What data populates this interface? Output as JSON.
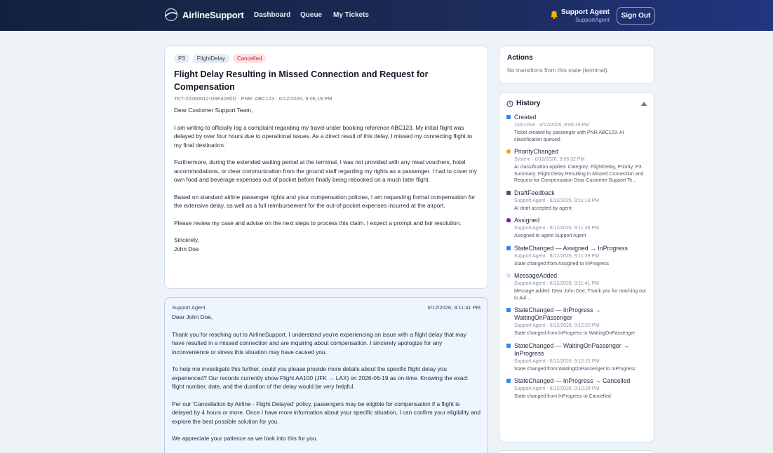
{
  "header": {
    "brand": "AirlineSupport",
    "nav": [
      "Dashboard",
      "Queue",
      "My Tickets"
    ],
    "agent_name": "Support Agent",
    "agent_sub": "SupportAgent",
    "signout_label": "Sign Out"
  },
  "ticket": {
    "badges": [
      "P3",
      "FlightDelay",
      "Cancelled"
    ],
    "title": "Flight Delay Resulting in Missed Connection and Request for Compensation",
    "meta": "TKT-20260612-D6E4280D · PNR: ABC123 · 6/12/2026, 9:06:19 PM",
    "body": [
      "Dear Customer Support Team,",
      "I am writing to officially log a complaint regarding my travel under booking reference ABC123. My initial flight was delayed by over four hours due to operational issues. As a direct result of this delay, I missed my connecting flight to my final destination.",
      "Furthermore, during the extended waiting period at the terminal, I was not provided with any meal vouchers, hotel accommodations, or clear communication from the ground staff regarding my rights as a passenger. I had to cover my own food and beverage expenses out of pocket before finally being rebooked on a much later flight.",
      "Based on standard airline passenger rights and your compensation policies, I am requesting formal compensation for the extensive delay, as well as a full reimbursement for the out-of-pocket expenses incurred at the airport.",
      "Please review my case and advise on the next steps to process this claim. I expect a prompt and fair resolution."
    ],
    "signoff": "Sincerely,",
    "signature": "John Doe"
  },
  "reply": {
    "author": "Support Agent",
    "time": "6/12/2026, 9:11:41 PM",
    "body": [
      "Dear John Doe,",
      "Thank you for reaching out to AirlineSupport. I understand you're experiencing an issue with a flight delay that may have resulted in a missed connection and are inquiring about compensation. I sincerely apologize for any inconvenience or stress this situation may have caused you.",
      "To help me investigate this further, could you please provide more details about the specific flight delay you experienced? Our records currently show Flight AA100 (JFK → LAX) on 2026-06-19 as on-time. Knowing the exact flight number, date, and the duration of the delay would be very helpful.",
      "Per our 'Cancellation by Airline - Flight Delayed' policy, passengers may be eligible for compensation if a flight is delayed by 4 hours or more. Once I have more information about your specific situation, I can confirm your eligibility and explore the best possible solution for you.",
      "We appreciate your patience as we look into this for you."
    ]
  },
  "actions": {
    "title": "Actions",
    "note": "No transitions from this state (terminal)."
  },
  "history": {
    "title": "History",
    "items": [
      {
        "name": "Created",
        "meta": "John Doe · 6/12/2026, 9:06:19 PM",
        "desc": "Ticket created by passenger with PNR ABC123. AI classification queued.",
        "color": "#3b82f6"
      },
      {
        "name": "PriorityChanged",
        "meta": "System · 6/12/2026, 9:06:32 PM",
        "desc": "AI classification applied. Category: FlightDelay, Priority: P3. Summary: Flight Delay Resulting in Missed Connection and Request for Compensation Dear Customer Support Te...",
        "color": "#f59e0b"
      },
      {
        "name": "DraftFeedback",
        "meta": "Support Agent · 6/12/2026, 9:11:18 PM",
        "desc": "AI draft accepted by agent",
        "color": "#4b5563"
      },
      {
        "name": "Assigned",
        "meta": "Support Agent · 6/12/2026, 9:11:36 PM",
        "desc": "Assigned to agent Support Agent",
        "color": "#6b21a8"
      },
      {
        "name": "StateChanged — Assigned → InProgress",
        "meta": "Support Agent · 6/12/2026, 9:11:39 PM",
        "desc": "State changed from Assigned to InProgress",
        "color": "#3b82f6"
      },
      {
        "name": "MessageAdded",
        "meta": "Support Agent · 6/12/2026, 9:11:41 PM",
        "desc": "Message added: Dear John Doe, Thank you for reaching out to Airl...",
        "color": "#c4b5fd"
      },
      {
        "name": "StateChanged — InProgress → WaitingOnPassenger",
        "meta": "Support Agent · 6/12/2026, 9:12:20 PM",
        "desc": "State changed from InProgress to WaitingOnPassenger",
        "color": "#3b82f6"
      },
      {
        "name": "StateChanged — WaitingOnPassenger → InProgress",
        "meta": "Support Agent · 6/12/2026, 9:12:21 PM",
        "desc": "State changed from WaitingOnPassenger to InProgress",
        "color": "#3b82f6"
      },
      {
        "name": "StateChanged — InProgress → Cancelled",
        "meta": "Support Agent · 6/12/2026, 9:12:24 PM",
        "desc": "State changed from InProgress to Cancelled",
        "color": "#3b82f6"
      }
    ]
  }
}
